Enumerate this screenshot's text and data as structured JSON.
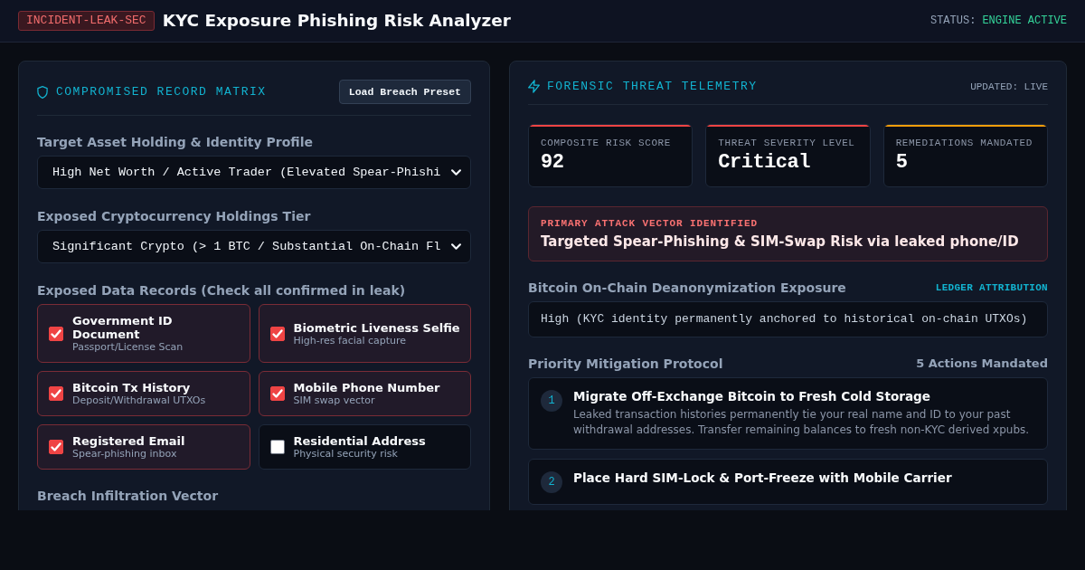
{
  "header": {
    "badge": "INCIDENT-LEAK-SEC",
    "title": "KYC Exposure Phishing Risk Analyzer",
    "status_label": "STATUS:",
    "status_value": "ENGINE ACTIVE"
  },
  "left_panel": {
    "title": "COMPROMISED RECORD MATRIX",
    "preset_button": "Load Breach Preset",
    "fields": [
      {
        "label": "Target Asset Holding & Identity Profile",
        "value": "High Net Worth / Active Trader (Elevated Spear-Phishi"
      },
      {
        "label": "Exposed Cryptocurrency Holdings Tier",
        "value": "Significant Crypto (> 1 BTC / Substantial On-Chain Fl"
      }
    ],
    "records_label": "Exposed Data Records (Check all confirmed in leak)",
    "records": [
      {
        "title": "Government ID Document",
        "description": "Passport/License Scan",
        "checked": true
      },
      {
        "title": "Biometric Liveness Selfie",
        "description": "High-res facial capture",
        "checked": true
      },
      {
        "title": "Bitcoin Tx History",
        "description": "Deposit/Withdrawal UTXOs",
        "checked": true
      },
      {
        "title": "Mobile Phone Number",
        "description": "SIM swap vector",
        "checked": true
      },
      {
        "title": "Registered Email",
        "description": "Spear-phishing inbox",
        "checked": true
      },
      {
        "title": "Residential Address",
        "description": "Physical security risk",
        "checked": false
      }
    ],
    "next_section_label": "Breach Infiltration Vector"
  },
  "right_panel": {
    "title": "FORENSIC THREAT TELEMETRY",
    "updated": "UPDATED: LIVE",
    "stats": [
      {
        "label": "COMPOSITE RISK SCORE",
        "value": "92",
        "color": "#ef4444"
      },
      {
        "label": "THREAT SEVERITY LEVEL",
        "value": "Critical",
        "color": "#ef4444"
      },
      {
        "label": "REMEDIATIONS MANDATED",
        "value": "5",
        "color": "#f59e0b"
      }
    ],
    "alert": {
      "label": "PRIMARY ATTACK VECTOR IDENTIFIED",
      "text": "Targeted Spear-Phishing & SIM-Swap Risk via leaked phone/ID"
    },
    "exposure": {
      "heading": "Bitcoin On-Chain Deanonymization Exposure",
      "tag": "LEDGER ATTRIBUTION",
      "value": "High (KYC identity permanently anchored to historical on-chain UTXOs)"
    },
    "mitigation": {
      "heading": "Priority Mitigation Protocol",
      "count": "5 Actions Mandated",
      "actions": [
        {
          "number": "1",
          "title": "Migrate Off-Exchange Bitcoin to Fresh Cold Storage",
          "description": "Leaked transaction histories permanently tie your real name and ID to your past withdrawal addresses. Transfer remaining balances to fresh non-KYC derived xpubs."
        },
        {
          "number": "2",
          "title": "Place Hard SIM-Lock & Port-Freeze with Mobile Carrier"
        }
      ]
    }
  }
}
